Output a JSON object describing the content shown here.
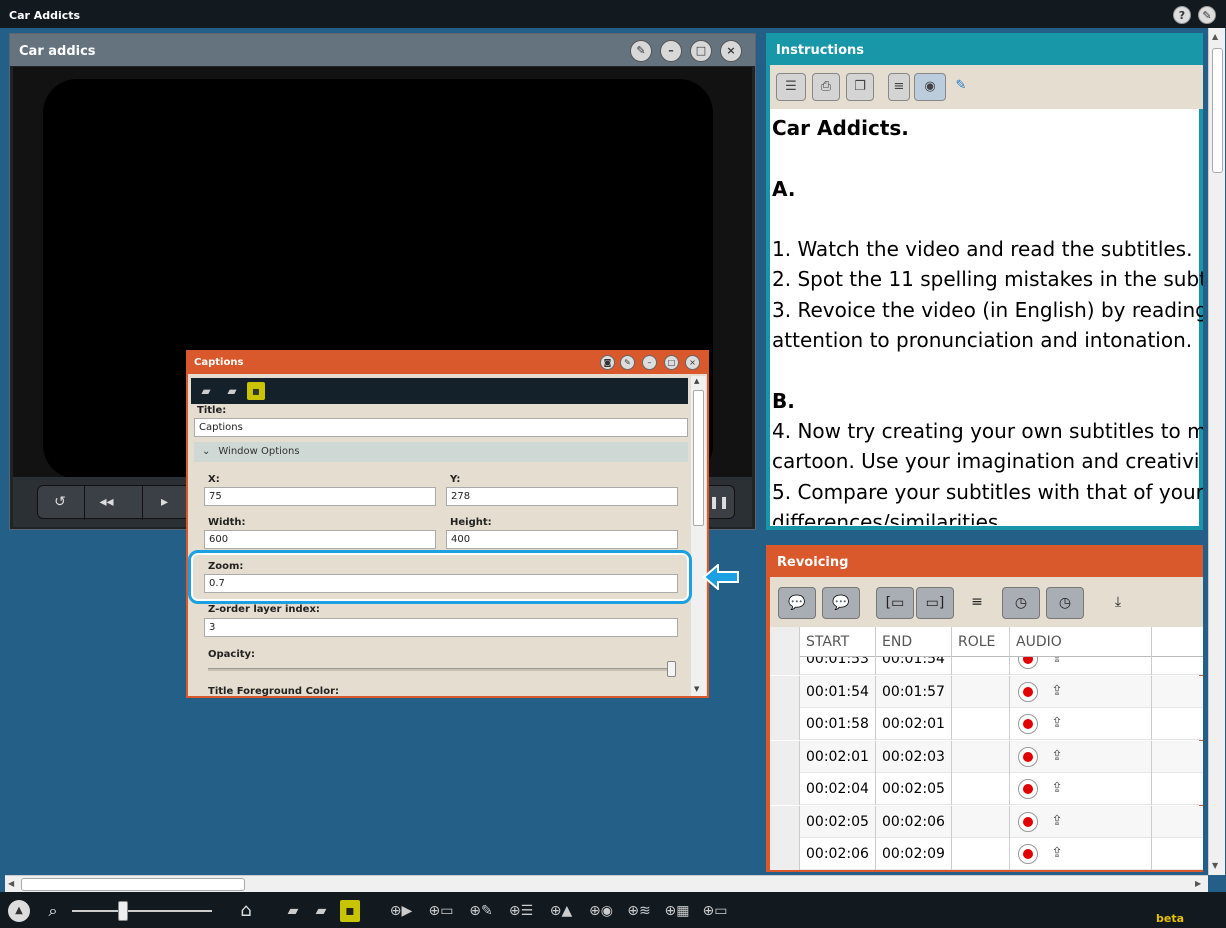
{
  "app": {
    "title": "Car Addicts"
  },
  "video_window": {
    "title": "Car addics"
  },
  "instructions": {
    "title": "Instructions",
    "lines": [
      {
        "text": "Car Addicts.",
        "bold": true
      },
      {
        "text": "",
        "bold": false
      },
      {
        "text": "A.",
        "bold": true
      },
      {
        "text": "",
        "bold": false
      },
      {
        "text": "1. Watch the video and read the subtitles.",
        "bold": false
      },
      {
        "text": "2. Spot the 11 spelling mistakes in the subt",
        "bold": false
      },
      {
        "text": "3. Revoice the video (in English) by reading",
        "bold": false
      },
      {
        "text": "attention to pronunciation and intonation.",
        "bold": false
      },
      {
        "text": "",
        "bold": false
      },
      {
        "text": "B.",
        "bold": true
      },
      {
        "text": "4. Now try creating your own subtitles to m",
        "bold": false
      },
      {
        "text": "cartoon. Use your imagination and creativi",
        "bold": false
      },
      {
        "text": "5. Compare your subtitles with that of your",
        "bold": false
      },
      {
        "text": "differences/similarities",
        "bold": false
      }
    ]
  },
  "revoicing": {
    "title": "Revoicing",
    "columns": [
      "START",
      "END",
      "ROLE",
      "AUDIO"
    ],
    "rows": [
      {
        "start": "00:01:53",
        "end": "00:01:54"
      },
      {
        "start": "00:01:54",
        "end": "00:01:57"
      },
      {
        "start": "00:01:58",
        "end": "00:02:01"
      },
      {
        "start": "00:02:01",
        "end": "00:02:03"
      },
      {
        "start": "00:02:04",
        "end": "00:02:05"
      },
      {
        "start": "00:02:05",
        "end": "00:02:06"
      },
      {
        "start": "00:02:06",
        "end": "00:02:09"
      }
    ]
  },
  "captions": {
    "title": "Captions",
    "title_label": "Title:",
    "title_value": "Captions",
    "section": "Window Options",
    "x_label": "X:",
    "x_value": "75",
    "y_label": "Y:",
    "y_value": "278",
    "width_label": "Width:",
    "width_value": "600",
    "height_label": "Height:",
    "height_value": "400",
    "zoom_label": "Zoom:",
    "zoom_value": "0.7",
    "z_label": "Z-order layer index:",
    "z_value": "3",
    "opacity_label": "Opacity:",
    "opacity_level": 1.0,
    "fg_label": "Title Foreground Color:"
  },
  "footer": {
    "beta": "beta",
    "zoom_level": 0.35
  },
  "colors": {
    "instructions": "#1897a8",
    "revoicing": "#d9582c",
    "highlight": "#1ba1e2",
    "background": "#245f87"
  }
}
